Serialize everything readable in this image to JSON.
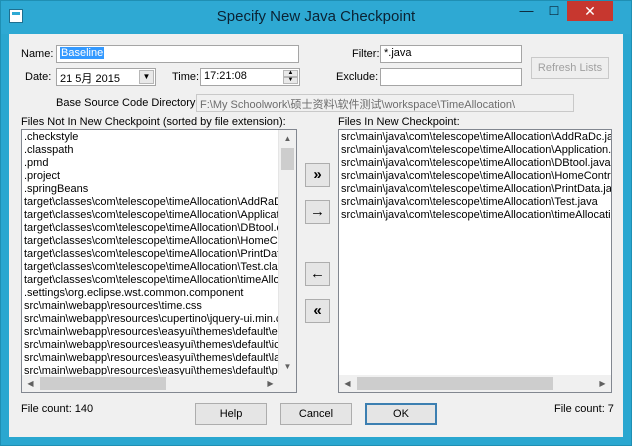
{
  "window": {
    "title": "Specify New Java Checkpoint",
    "controls": {
      "minimize": "—",
      "maximize": "☐",
      "close": "✕"
    }
  },
  "form": {
    "name_label": "Name:",
    "name_value": "Baseline",
    "date_label": "Date:",
    "date_value": "21  5月  2015",
    "time_label": "Time:",
    "time_value": "17:21:08",
    "filter_label": "Filter:",
    "filter_value": "*.java",
    "exclude_label": "Exclude:",
    "exclude_value": "",
    "refresh_label": "Refresh Lists",
    "base_dir_label": "Base Source Code Directory:",
    "base_dir_value": "F:\\My Schoolwork\\硕士资料\\软件测试\\workspace\\TimeAllocation\\"
  },
  "left_list": {
    "header": "Files Not In New Checkpoint (sorted by file extension):",
    "items": [
      ".checkstyle",
      ".classpath",
      ".pmd",
      ".project",
      ".springBeans",
      "target\\classes\\com\\telescope\\timeAllocation\\AddRaDc",
      "target\\classes\\com\\telescope\\timeAllocation\\Application",
      "target\\classes\\com\\telescope\\timeAllocation\\DBtool.cla",
      "target\\classes\\com\\telescope\\timeAllocation\\HomeContr",
      "target\\classes\\com\\telescope\\timeAllocation\\PrintData.cl",
      "target\\classes\\com\\telescope\\timeAllocation\\Test.class",
      "target\\classes\\com\\telescope\\timeAllocation\\timeAllocati",
      ".settings\\org.eclipse.wst.common.component",
      "src\\main\\webapp\\resources\\time.css",
      "src\\main\\webapp\\resources\\cupertino\\jquery-ui.min.css",
      "src\\main\\webapp\\resources\\easyui\\themes\\default\\easyui",
      "src\\main\\webapp\\resources\\easyui\\themes\\default\\icon",
      "src\\main\\webapp\\resources\\easyui\\themes\\default\\layout",
      "src\\main\\webapp\\resources\\easyui\\themes\\default\\panel"
    ],
    "file_count": "File count: 140"
  },
  "right_list": {
    "header": "Files In New Checkpoint:",
    "items": [
      "src\\main\\java\\com\\telescope\\timeAllocation\\AddRaDc.java",
      "src\\main\\java\\com\\telescope\\timeAllocation\\Application.java",
      "src\\main\\java\\com\\telescope\\timeAllocation\\DBtool.java",
      "src\\main\\java\\com\\telescope\\timeAllocation\\HomeController.java",
      "src\\main\\java\\com\\telescope\\timeAllocation\\PrintData.java",
      "src\\main\\java\\com\\telescope\\timeAllocation\\Test.java",
      "src\\main\\java\\com\\telescope\\timeAllocation\\timeAllocation.java"
    ],
    "file_count": "File count: 7"
  },
  "move_buttons": {
    "add_all": "»",
    "add": "→",
    "remove": "←",
    "remove_all": "«"
  },
  "buttons": {
    "help": "Help",
    "cancel": "Cancel",
    "ok": "OK"
  }
}
